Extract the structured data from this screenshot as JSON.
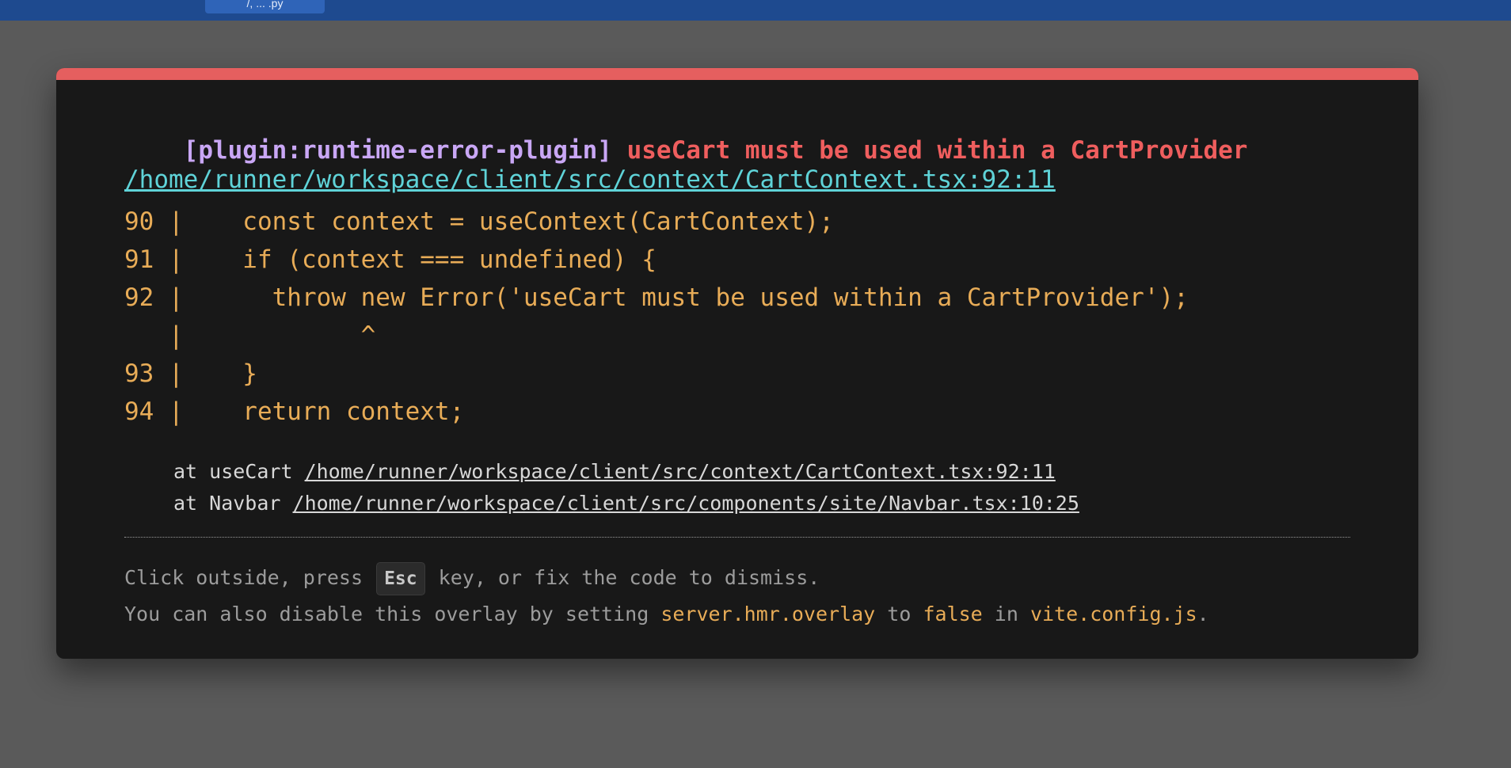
{
  "topbar": {
    "tab_label": "/, ... .py"
  },
  "overlay": {
    "plugin": "[plugin:runtime-error-plugin]",
    "message": "useCart must be used within a CartProvider",
    "file": "/home/runner/workspace/client/src/context/CartContext.tsx:92:11",
    "frame": [
      "90 |    const context = useContext(CartContext);",
      "91 |    if (context === undefined) {",
      "92 |      throw new Error('useCart must be used within a CartProvider');",
      "   |            ^",
      "93 |    }",
      "94 |    return context;"
    ],
    "stack": [
      {
        "prefix": "at useCart ",
        "loc": "/home/runner/workspace/client/src/context/CartContext.tsx:92:11"
      },
      {
        "prefix": "at Navbar ",
        "loc": "/home/runner/workspace/client/src/components/site/Navbar.tsx:10:25"
      }
    ],
    "tip1": {
      "before": "Click outside, press ",
      "key": "Esc",
      "after": " key, or fix the code to dismiss."
    },
    "tip2": {
      "t1": "You can also disable this overlay by setting ",
      "c1": "server.hmr.overlay",
      "t2": " to ",
      "c2": "false",
      "t3": " in ",
      "c3": "vite.config.js",
      "t4": "."
    }
  },
  "colors": {
    "accent": "#e55f5f",
    "plugin": "#c9a7f5",
    "error": "#ef5e5e",
    "link": "#5fd3d8",
    "code": "#e8ac57"
  }
}
